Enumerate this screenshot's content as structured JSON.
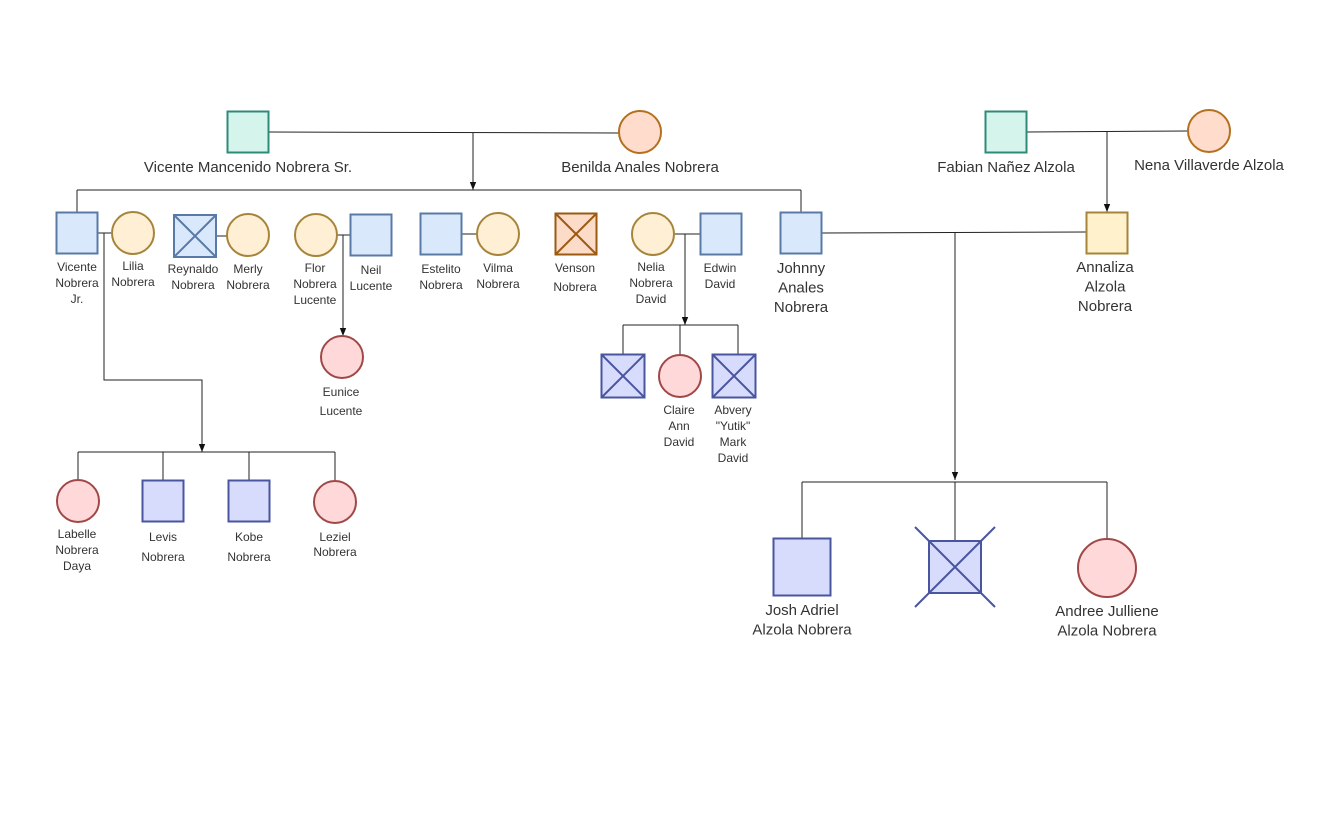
{
  "styles": {
    "green": {
      "fill": "#d5f5ec",
      "stroke": "#2e8b7a"
    },
    "peach": {
      "fill": "#ffdccc",
      "stroke": "#b4701f"
    },
    "cream": {
      "fill": "#ffefd5",
      "stroke": "#a6853a"
    },
    "blue": {
      "fill": "#dae8fc",
      "stroke": "#5a7aa6"
    },
    "violet": {
      "fill": "#d8dcfc",
      "stroke": "#4a55a0"
    },
    "pink": {
      "fill": "#ffd9d9",
      "stroke": "#a04848"
    },
    "yellow": {
      "fill": "#fff1cc",
      "stroke": "#a6853a"
    },
    "orange": {
      "fill": "#fcdcc8",
      "stroke": "#9b5a10"
    }
  },
  "people": [
    {
      "id": "vicente-sr",
      "shape": "square",
      "style": "green",
      "deceased": false,
      "label": [
        "Vicente Mancenido Nobrera Sr."
      ]
    },
    {
      "id": "benilda",
      "shape": "circle",
      "style": "peach",
      "deceased": false,
      "label": [
        "Benilda Anales Nobrera"
      ]
    },
    {
      "id": "fabian",
      "shape": "square",
      "style": "green",
      "deceased": false,
      "label": [
        "Fabian Nañez Alzola"
      ]
    },
    {
      "id": "nena",
      "shape": "circle",
      "style": "peach",
      "deceased": false,
      "label": [
        "Nena Villaverde Alzola"
      ]
    },
    {
      "id": "annaliza",
      "shape": "square",
      "style": "yellow",
      "deceased": false,
      "label": [
        "Annaliza",
        "Alzola",
        "Nobrera"
      ]
    },
    {
      "id": "vicente-jr",
      "shape": "square",
      "style": "blue",
      "deceased": false,
      "label": [
        "Vicente",
        "Nobrera",
        "Jr."
      ]
    },
    {
      "id": "lilia",
      "shape": "circle",
      "style": "cream",
      "deceased": false,
      "label": [
        "Lilia",
        "Nobrera"
      ]
    },
    {
      "id": "reynaldo",
      "shape": "square",
      "style": "blue",
      "deceased": true,
      "label": [
        "Reynaldo",
        "Nobrera"
      ]
    },
    {
      "id": "merly",
      "shape": "circle",
      "style": "cream",
      "deceased": false,
      "label": [
        "Merly",
        "Nobrera"
      ]
    },
    {
      "id": "flor",
      "shape": "circle",
      "style": "cream",
      "deceased": false,
      "label": [
        "Flor",
        "Nobrera",
        "Lucente"
      ]
    },
    {
      "id": "neil",
      "shape": "square",
      "style": "blue",
      "deceased": false,
      "label": [
        "Neil",
        "Lucente"
      ]
    },
    {
      "id": "eunice",
      "shape": "circle",
      "style": "pink",
      "deceased": false,
      "label": [
        "Eunice",
        "Lucente"
      ]
    },
    {
      "id": "estelito",
      "shape": "square",
      "style": "blue",
      "deceased": false,
      "label": [
        "Estelito",
        "Nobrera"
      ]
    },
    {
      "id": "vilma",
      "shape": "circle",
      "style": "cream",
      "deceased": false,
      "label": [
        "Vilma",
        "Nobrera"
      ]
    },
    {
      "id": "venson",
      "shape": "square",
      "style": "orange",
      "deceased": true,
      "label": [
        "Venson",
        "Nobrera"
      ]
    },
    {
      "id": "nelia",
      "shape": "circle",
      "style": "cream",
      "deceased": false,
      "label": [
        "Nelia",
        "Nobrera",
        "David"
      ]
    },
    {
      "id": "edwin",
      "shape": "square",
      "style": "blue",
      "deceased": false,
      "label": [
        "Edwin",
        "David"
      ]
    },
    {
      "id": "johnny",
      "shape": "square",
      "style": "blue",
      "deceased": false,
      "label": [
        "Johnny",
        "Anales",
        "Nobrera"
      ]
    },
    {
      "id": "david-child-1",
      "shape": "square",
      "style": "violet",
      "deceased": true,
      "label": []
    },
    {
      "id": "claire",
      "shape": "circle",
      "style": "pink",
      "deceased": false,
      "label": [
        "Claire",
        "Ann",
        "David"
      ]
    },
    {
      "id": "abvery",
      "shape": "square",
      "style": "violet",
      "deceased": true,
      "label": [
        "Abvery",
        "\"Yutik\"",
        "Mark",
        "David"
      ]
    },
    {
      "id": "labelle",
      "shape": "circle",
      "style": "pink",
      "deceased": false,
      "label": [
        "Labelle",
        "Nobrera",
        "Daya"
      ]
    },
    {
      "id": "levis",
      "shape": "square",
      "style": "violet",
      "deceased": false,
      "label": [
        "Levis",
        "Nobrera"
      ]
    },
    {
      "id": "kobe",
      "shape": "square",
      "style": "violet",
      "deceased": false,
      "label": [
        "Kobe",
        "Nobrera"
      ]
    },
    {
      "id": "leziel",
      "shape": "circle",
      "style": "pink",
      "deceased": false,
      "label": [
        "Leziel",
        "Nobrera"
      ]
    },
    {
      "id": "josh",
      "shape": "square",
      "style": "violet",
      "deceased": false,
      "label": [
        "Josh Adriel",
        "Alzola Nobrera"
      ]
    },
    {
      "id": "alzola-child-2",
      "shape": "square",
      "style": "violet",
      "deceased": true,
      "label": []
    },
    {
      "id": "andree",
      "shape": "circle",
      "style": "pink",
      "deceased": false,
      "label": [
        "Andree Julliene",
        "Alzola Nobrera"
      ]
    }
  ]
}
